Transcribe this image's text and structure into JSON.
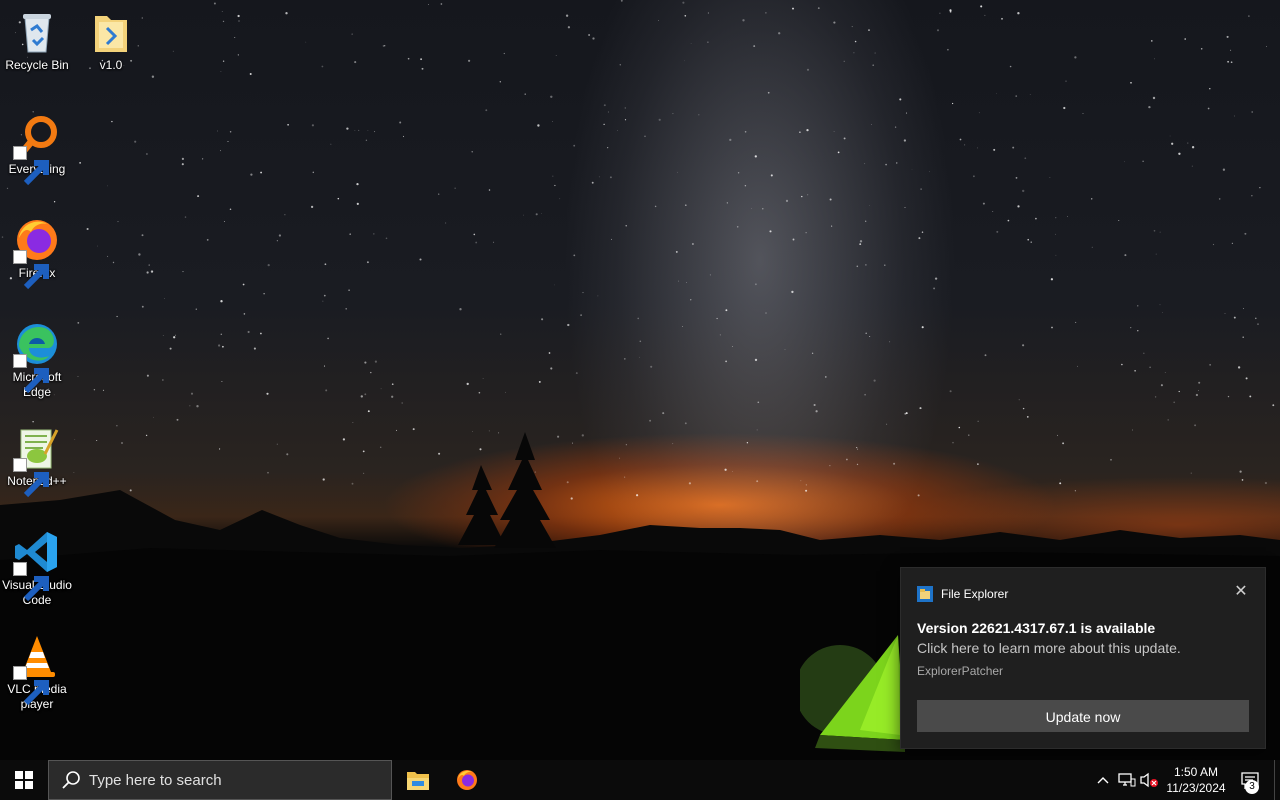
{
  "desktop": {
    "icons": [
      {
        "label": "Recycle Bin",
        "icon": "recycle-bin-icon"
      },
      {
        "label": "v1.0",
        "icon": "folder-icon"
      },
      {
        "label": "Everything",
        "icon": "everything-search-icon"
      },
      {
        "label": "Firefox",
        "icon": "firefox-icon"
      },
      {
        "label": "Microsoft Edge",
        "icon": "edge-icon"
      },
      {
        "label": "Notepad++",
        "icon": "notepad-plus-plus-icon"
      },
      {
        "label": "Visual Studio Code",
        "icon": "vscode-icon"
      },
      {
        "label": "VLC media player",
        "icon": "vlc-icon"
      }
    ]
  },
  "notification": {
    "app_name": "File Explorer",
    "title": "Version 22621.4317.67.1 is available",
    "body": "Click here to learn more about this update.",
    "attribution": "ExplorerPatcher",
    "action_label": "Update now",
    "close_glyph": "✕"
  },
  "taskbar": {
    "search_placeholder": "Type here to search",
    "pinned": [
      {
        "name": "file-explorer-icon"
      },
      {
        "name": "firefox-icon"
      }
    ],
    "clock": {
      "time": "1:50 AM",
      "date": "11/23/2024"
    },
    "notification_count": "3"
  },
  "colors": {
    "taskbar": "#0b0b0b",
    "toast_bg": "#1f1f1f",
    "toast_button": "#4a4a4a",
    "horizon_glow": "#e8650f"
  }
}
